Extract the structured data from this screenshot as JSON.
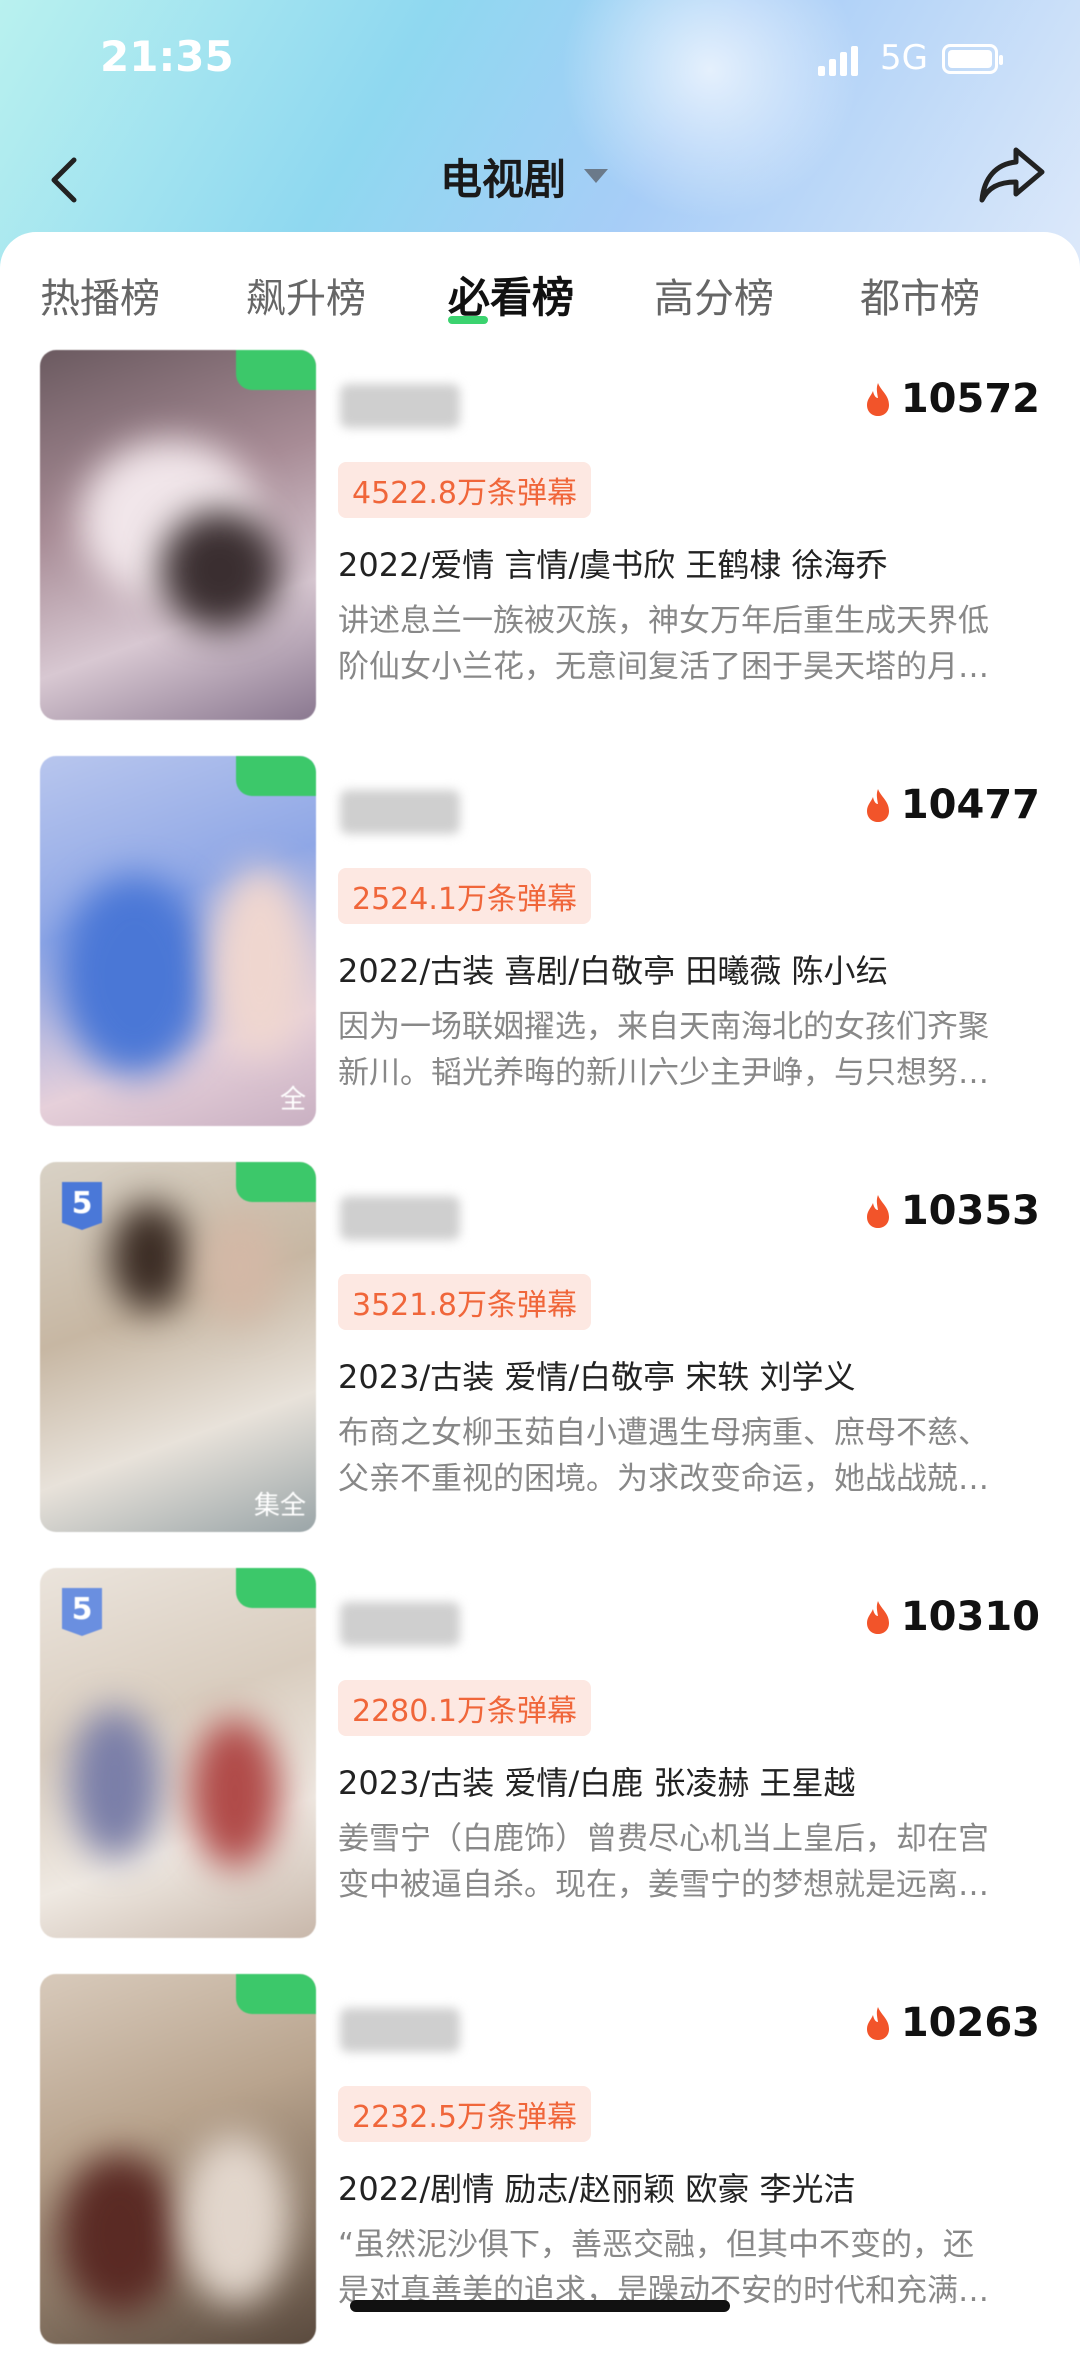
{
  "status_bar": {
    "time": "21:35",
    "network": "5G"
  },
  "nav": {
    "title": "电视剧",
    "back_icon": "back-arrow-icon",
    "share_icon": "share-icon"
  },
  "tabs": [
    {
      "label": "热播榜",
      "active": false
    },
    {
      "label": "飙升榜",
      "active": false
    },
    {
      "label": "必看榜",
      "active": true
    },
    {
      "label": "高分榜",
      "active": false
    },
    {
      "label": "都市榜",
      "active": false
    }
  ],
  "accent_color": "#3bd36f",
  "danmu_color": "#f0663a",
  "items": [
    {
      "heat": "10572",
      "danmu": "4522.8万条弹幕",
      "meta": "2022/爱情 言情/虞书欣 王鹤棣 徐海乔",
      "desc_line1": "讲述息兰一族被灭族，神女万年后重生成天界低",
      "desc_line2": "阶仙女小兰花，无意间复活了困于昊天塔的月…",
      "rank": "",
      "episodes": ""
    },
    {
      "heat": "10477",
      "danmu": "2524.1万条弹幕",
      "meta": "2022/古装 喜剧/白敬亭 田曦薇 陈小纭",
      "desc_line1": "因为一场联姻擢选，来自天南海北的女孩们齐聚",
      "desc_line2": "新川。韬光养晦的新川六少主尹峥，与只想努…",
      "rank": "",
      "episodes": "全"
    },
    {
      "heat": "10353",
      "danmu": "3521.8万条弹幕",
      "meta": "2023/古装 爱情/白敬亭 宋轶 刘学义",
      "desc_line1": "布商之女柳玉茹自小遭遇生母病重、庶母不慈、",
      "desc_line2": "父亲不重视的困境。为求改变命运，她战战兢…",
      "rank": "5",
      "episodes": "集全"
    },
    {
      "heat": "10310",
      "danmu": "2280.1万条弹幕",
      "meta": "2023/古装 爱情/白鹿 张凌赫 王星越",
      "desc_line1": "姜雪宁（白鹿饰）曾费尽心机当上皇后，却在宫",
      "desc_line2": "变中被逼自杀。现在，姜雪宁的梦想就是远离…",
      "rank": "5",
      "episodes": ""
    },
    {
      "heat": "10263",
      "danmu": "2232.5万条弹幕",
      "meta": "2022/剧情 励志/赵丽颖 欧豪 李光洁",
      "desc_line1": "“虽然泥沙俱下，善恶交融，但其中不变的，还",
      "desc_line2": "是对真善美的追求，是躁动不安的时代和充满…",
      "rank": "",
      "episodes": ""
    }
  ]
}
